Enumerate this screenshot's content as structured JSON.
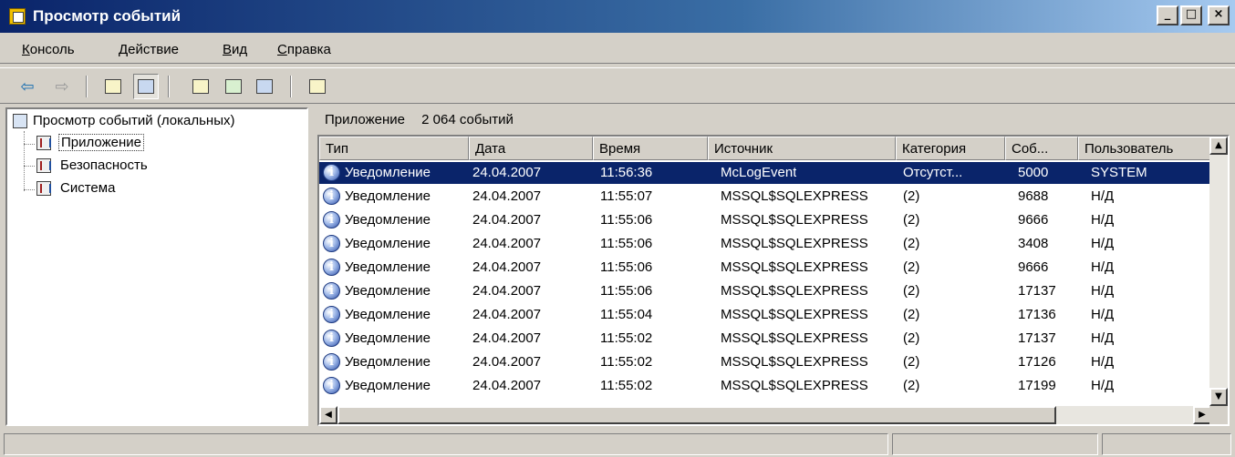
{
  "window": {
    "title": "Просмотр событий"
  },
  "menu": [
    {
      "label": "Консоль",
      "accel": "К",
      "rest": "онсоль"
    },
    {
      "label": "Действие",
      "accel": "Д",
      "rest": "ействие"
    },
    {
      "label": "Вид",
      "accel": "В",
      "rest": "ид"
    },
    {
      "label": "Справка",
      "accel": "С",
      "rest": "правка"
    }
  ],
  "tree": {
    "root": "Просмотр событий (локальных)",
    "items": [
      "Приложение",
      "Безопасность",
      "Система"
    ]
  },
  "panel": {
    "name": "Приложение",
    "count": "2 064 событий"
  },
  "columns": [
    "Тип",
    "Дата",
    "Время",
    "Источник",
    "Категория",
    "Соб...",
    "Пользователь"
  ],
  "rows": [
    [
      "Уведомление",
      "24.04.2007",
      "11:56:36",
      "McLogEvent",
      "Отсутст...",
      "5000",
      "SYSTEM"
    ],
    [
      "Уведомление",
      "24.04.2007",
      "11:55:07",
      "MSSQL$SQLEXPRESS",
      "(2)",
      "9688",
      "Н/Д"
    ],
    [
      "Уведомление",
      "24.04.2007",
      "11:55:06",
      "MSSQL$SQLEXPRESS",
      "(2)",
      "9666",
      "Н/Д"
    ],
    [
      "Уведомление",
      "24.04.2007",
      "11:55:06",
      "MSSQL$SQLEXPRESS",
      "(2)",
      "3408",
      "Н/Д"
    ],
    [
      "Уведомление",
      "24.04.2007",
      "11:55:06",
      "MSSQL$SQLEXPRESS",
      "(2)",
      "9666",
      "Н/Д"
    ],
    [
      "Уведомление",
      "24.04.2007",
      "11:55:06",
      "MSSQL$SQLEXPRESS",
      "(2)",
      "17137",
      "Н/Д"
    ],
    [
      "Уведомление",
      "24.04.2007",
      "11:55:04",
      "MSSQL$SQLEXPRESS",
      "(2)",
      "17136",
      "Н/Д"
    ],
    [
      "Уведомление",
      "24.04.2007",
      "11:55:02",
      "MSSQL$SQLEXPRESS",
      "(2)",
      "17137",
      "Н/Д"
    ],
    [
      "Уведомление",
      "24.04.2007",
      "11:55:02",
      "MSSQL$SQLEXPRESS",
      "(2)",
      "17126",
      "Н/Д"
    ],
    [
      "Уведомление",
      "24.04.2007",
      "11:55:02",
      "MSSQL$SQLEXPRESS",
      "(2)",
      "17199",
      "Н/Д"
    ]
  ],
  "selected_row": 0,
  "colors": {
    "titlebar": "#0a246a",
    "selection": "#0a246a",
    "chrome": "#d4d0c8"
  },
  "icons": {
    "toolbar": [
      "back-arrow-icon",
      "forward-arrow-icon",
      "up-folder-icon",
      "show-hide-tree-icon",
      "properties-icon",
      "refresh-icon",
      "export-list-icon",
      "help-icon"
    ],
    "row": "info-icon"
  }
}
